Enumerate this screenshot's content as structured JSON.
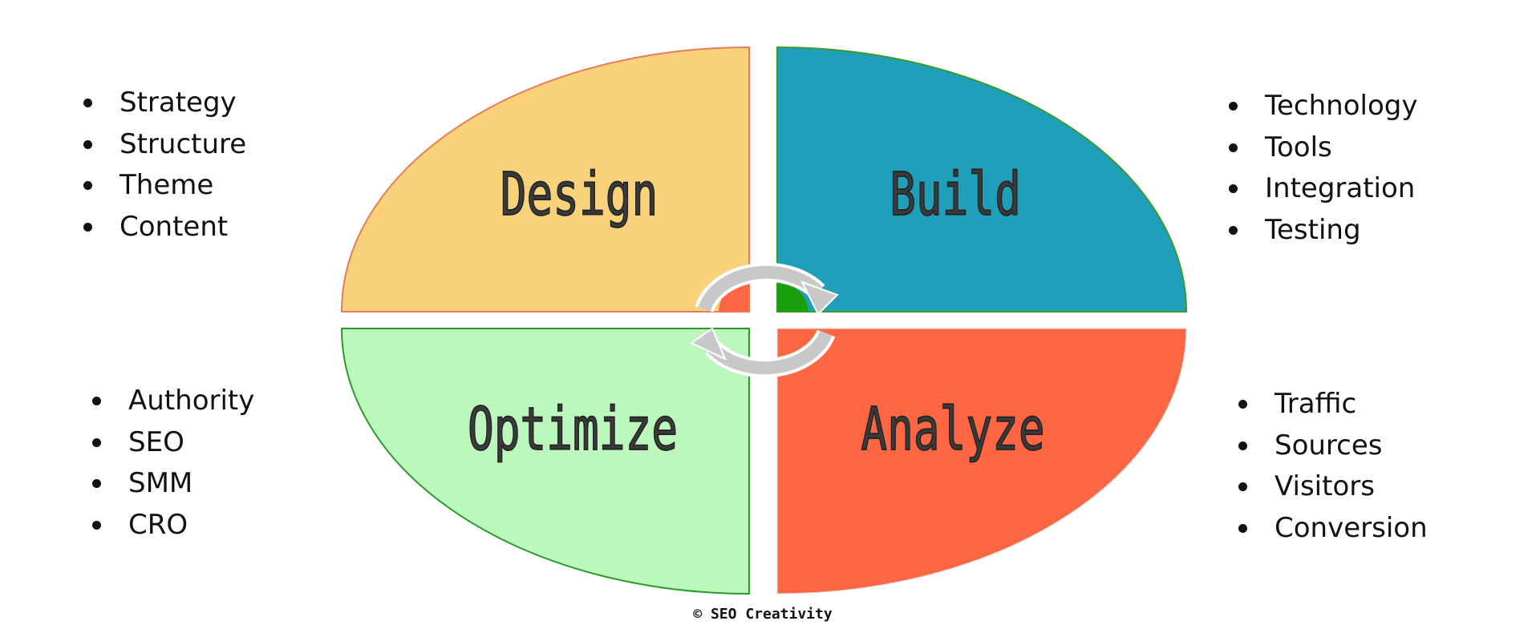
{
  "quadrants": {
    "design": {
      "label": "Design",
      "color": "#fbd27c",
      "items": [
        "Strategy",
        "Structure",
        "Theme",
        "Content"
      ]
    },
    "build": {
      "label": "Build",
      "color": "#209fba",
      "items": [
        "Technology",
        "Tools",
        "Integration",
        "Testing"
      ]
    },
    "optimize": {
      "label": "Optimize",
      "color": "#bcf7bd",
      "items": [
        "Authority",
        "SEO",
        "SMM",
        "CRO"
      ]
    },
    "analyze": {
      "label": "Analyze",
      "color": "#ff6644",
      "items": [
        "Traffic",
        "Sources",
        "Visitors",
        "Conversion"
      ]
    }
  },
  "arrows": {
    "color": "#c8c8c8",
    "icon": "cycle-arrows-icon"
  },
  "copyright": "© SEO Creativity"
}
